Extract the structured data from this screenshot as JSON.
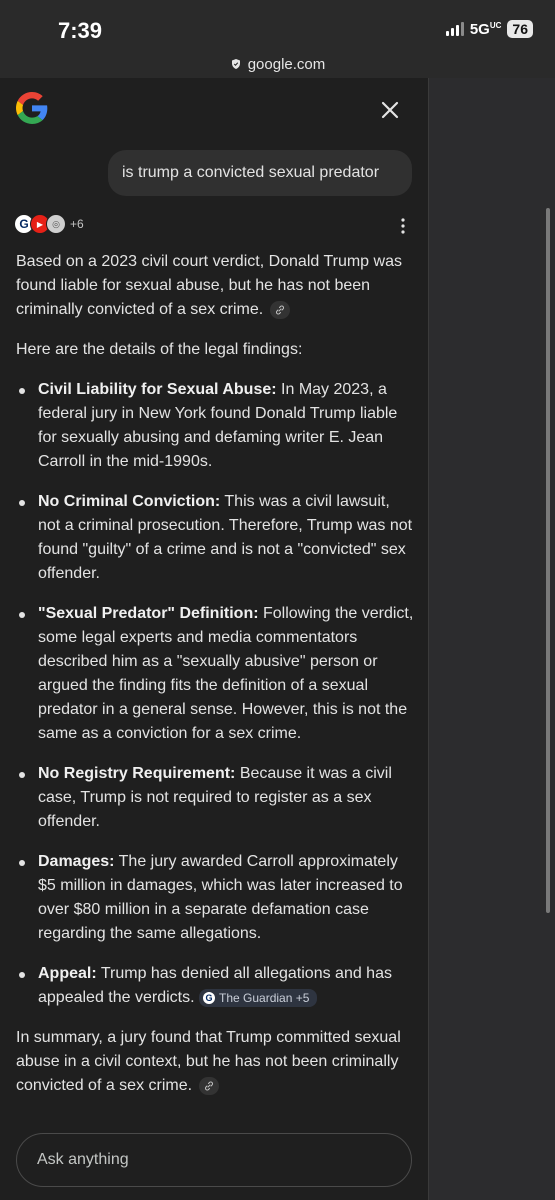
{
  "status": {
    "time": "7:39",
    "network": "5G",
    "network_sup": "UC",
    "battery": "76"
  },
  "browser": {
    "url": "google.com"
  },
  "header": {
    "close_label": "✕"
  },
  "query": "is trump a convicted sexual predator",
  "sources": {
    "more": "+6"
  },
  "answer": {
    "lead": "Based on a 2023 civil court verdict, Donald Trump was found liable for sexual abuse, but he has not been criminally convicted of a sex crime.",
    "intro": "Here are the details of the legal findings:",
    "bullets": [
      {
        "title": "Civil Liability for Sexual Abuse:",
        "text": " In May 2023, a federal jury in New York found Donald Trump liable for sexually abusing and defaming writer E. Jean Carroll in the mid-1990s."
      },
      {
        "title": "No Criminal Conviction:",
        "text": " This was a civil lawsuit, not a criminal prosecution. Therefore, Trump was not found \"guilty\" of a crime and is not a \"convicted\" sex offender."
      },
      {
        "title": "\"Sexual Predator\" Definition:",
        "text": " Following the verdict, some legal experts and media commentators described him as a \"sexually abusive\" person or argued the finding fits the definition of a sexual predator in a general sense. However, this is not the same as a conviction for a sex crime."
      },
      {
        "title": "No Registry Requirement:",
        "text": " Because it was a civil case, Trump is not required to register as a sex offender."
      },
      {
        "title": "Damages:",
        "text": " The jury awarded Carroll approximately $5 million in damages, which was later increased to over $80 million in a separate defamation case regarding the same allegations."
      },
      {
        "title": "Appeal:",
        "text": " Trump has denied all allegations and has appealed the verdicts. "
      }
    ],
    "source_chip": "The Guardian +5",
    "summary": "In summary, a jury found that Trump committed sexual abuse in a civil context, but he has not been criminally convicted of a sex crime."
  },
  "input": {
    "placeholder": "Ask anything"
  },
  "colors": {
    "background": "#1f1f1f",
    "text": "#e3e3e3",
    "bubble": "#303030",
    "side_panel": "#2c2c2e"
  },
  "icons": [
    "google-logo-icon",
    "close-icon",
    "more-vert-icon",
    "link-icon",
    "lock-icon",
    "signal-icon",
    "battery-icon"
  ]
}
